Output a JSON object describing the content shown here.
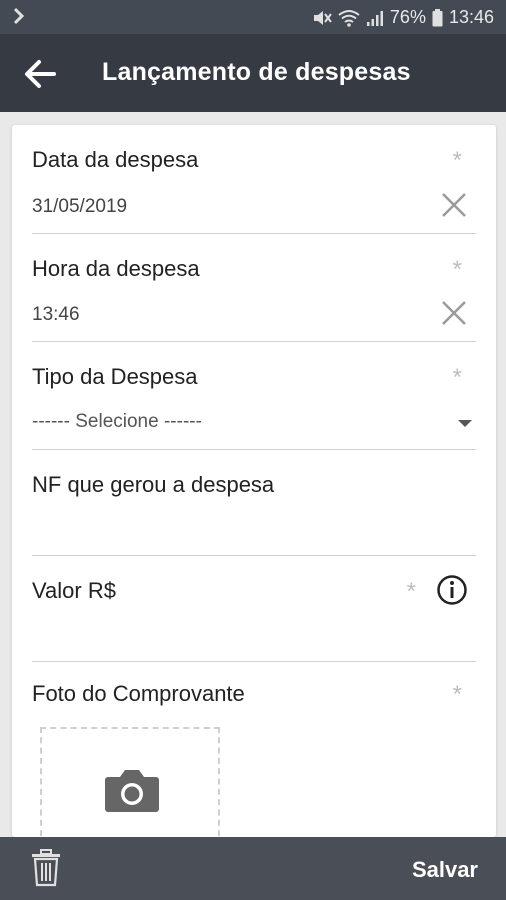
{
  "status": {
    "battery": "76%",
    "time": "13:46"
  },
  "appbar": {
    "title": "Lançamento de despesas"
  },
  "fields": {
    "data": {
      "label": "Data da despesa",
      "value": "31/05/2019",
      "required": "*"
    },
    "hora": {
      "label": "Hora da despesa",
      "value": "13:46",
      "required": "*"
    },
    "tipo": {
      "label": "Tipo da Despesa",
      "placeholder": "------  Selecione  ------",
      "required": "*"
    },
    "nf": {
      "label": "NF que gerou a despesa"
    },
    "valor": {
      "label": "Valor R$",
      "required": "*"
    },
    "foto": {
      "label": "Foto do Comprovante",
      "required": "*"
    }
  },
  "bottombar": {
    "save_label": "Salvar"
  },
  "icons": {
    "back": "arrow-left-icon",
    "clear": "close-icon",
    "info": "info-icon",
    "camera": "camera-icon",
    "trash": "trash-icon"
  },
  "colors": {
    "appbar": "#363a43",
    "statusbar": "#444a53",
    "bottombar": "#4a4e56",
    "background": "#e9e9e9"
  }
}
